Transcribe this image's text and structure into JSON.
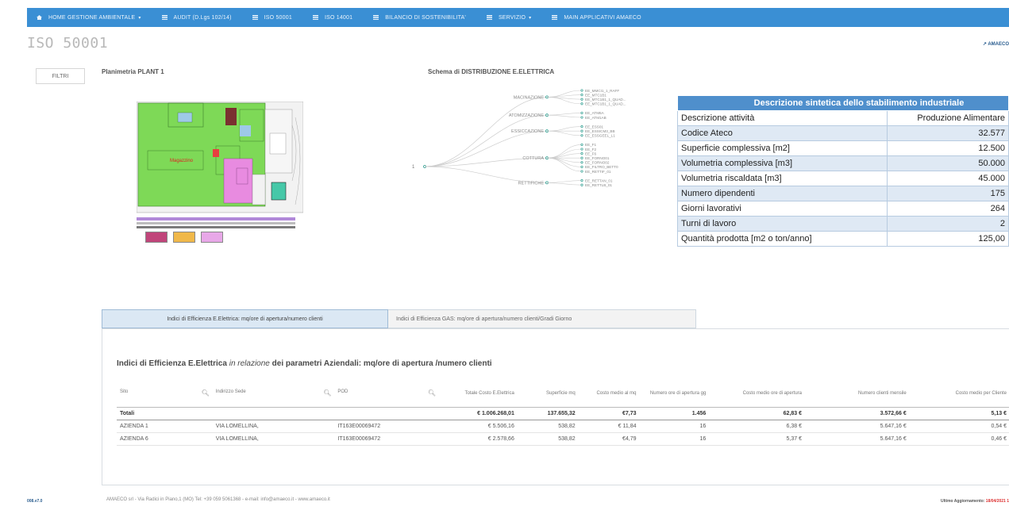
{
  "nav": {
    "items": [
      {
        "label": "HOME GESTIONE AMBIENTALE",
        "icon": "home-icon",
        "dropdown": true
      },
      {
        "label": "AUDIT (D.Lgs 102/14)",
        "icon": "list-icon",
        "dropdown": false
      },
      {
        "label": "ISO 50001",
        "icon": "list-icon",
        "dropdown": false
      },
      {
        "label": "ISO 14001",
        "icon": "list-icon",
        "dropdown": false
      },
      {
        "label": "BILANCIO DI SOSTENIBILITA'",
        "icon": "list-icon",
        "dropdown": false
      },
      {
        "label": "SERVIZIO",
        "icon": "list-icon",
        "dropdown": true
      },
      {
        "label": "MAIN APPLICATIVI AMAECO",
        "icon": "list-icon",
        "dropdown": false
      }
    ]
  },
  "page": {
    "title": "ISO 50001",
    "user_link": "↗ AMAECO"
  },
  "filter_button": "FILTRI",
  "planimetria": {
    "title": "Planimetria PLANT 1",
    "room_label": "Magazzino",
    "legend": [
      "",
      "",
      ""
    ]
  },
  "schema": {
    "title": "Schema di DISTRIBUZIONE E.ELETTRICA",
    "root": "1",
    "groups": [
      {
        "name": "MACINAZIONE",
        "leaves": [
          "EE_MMCI1_1_RAFF",
          "EE_MTC1B1",
          "EE_MTC1B1_1_QUAD...",
          "EE_MTC1B1_1_QUAD..."
        ]
      },
      {
        "name": "ATOMIZZAZIONE",
        "leaves": [
          "EE_ATM6A",
          "EE_ATM1AB"
        ]
      },
      {
        "name": "ESSICCAZIONE",
        "leaves": [
          "EE_ESS01",
          "EE_ESSICM3_BB",
          "EE_ESSGEEL_L1"
        ]
      },
      {
        "name": "COTTURA",
        "leaves": [
          "EE_F1",
          "EE_F2",
          "EE_F6",
          "EE_FORNO01",
          "EE_FORNO02",
          "EE_FILTRO_BETT0",
          "EE_RETTIF_01"
        ]
      },
      {
        "name": "RETTIFICHE",
        "leaves": [
          "EE_RETTAN_01",
          "EE_RETTLB_01"
        ]
      }
    ]
  },
  "description": {
    "header": "Descrizione sintetica dello stabilimento industriale",
    "rows": [
      {
        "label": "Descrizione attività",
        "value": "Produzione Alimentare"
      },
      {
        "label": "Codice Ateco",
        "value": "32.577"
      },
      {
        "label": "Superficie complessiva [m2]",
        "value": "12.500"
      },
      {
        "label": "Volumetria complessiva [m3]",
        "value": "50.000"
      },
      {
        "label": "Volumetria riscaldata [m3]",
        "value": "45.000"
      },
      {
        "label": "Numero dipendenti",
        "value": "175"
      },
      {
        "label": "Giorni lavorativi",
        "value": "264"
      },
      {
        "label": "Turni di lavoro",
        "value": "2"
      },
      {
        "label": "Quantità prodotta [m2 o ton/anno]",
        "value": "125,00"
      }
    ]
  },
  "tabs": [
    {
      "label": "Indici di Efficienza E.Elettrica: mq/ore di apertura/numero clienti",
      "active": true
    },
    {
      "label": "Indici di Efficienza GAS: mq/ore di apertura/numero clienti/Gradi Giorno",
      "active": false
    }
  ],
  "panel": {
    "title_strong": "Indici di Efficienza E.Elettrica",
    "title_em": "in relazione",
    "title_rest": "dei parametri Aziendali: mq/ore di apertura /numero clienti"
  },
  "grid": {
    "columns": [
      "Sito",
      "Indirizzo Sede",
      "POD",
      "Totale Costo E.Elettrica",
      "Superficie mq",
      "Costo medio al mq",
      "Numero ore di apertura gg",
      "Costo medio ore di apertura",
      "Numero clienti mensile",
      "Costo medio per Cliente"
    ],
    "total": [
      "Totali",
      "",
      "",
      "€ 1.006.268,01",
      "137.655,32",
      "€7,73",
      "1.456",
      "62,83 €",
      "3.572,66 €",
      "5,13 €"
    ],
    "rows": [
      [
        "AZIENDA 1",
        "VIA LOMELLINA,",
        "IT163E00069472",
        "€ 5.506,16",
        "538,82",
        "€ 11,84",
        "16",
        "6,38 €",
        "5.647,16 €",
        "0,54 €"
      ],
      [
        "AZIENDA 6",
        "VIA LOMELLINA,",
        "IT163E00069472",
        "€ 2.578,66",
        "538,82",
        "€4,79",
        "16",
        "5,37 €",
        "5.647,16 €",
        "0,46 €"
      ]
    ]
  },
  "footer": {
    "version": "008.v7.0",
    "text": "AMAECO srl - Via Radici in Piano,1 (MO) Tel: +39 059 5061368 - e-mail: info@amaeco.it - www.amaeco.it",
    "updated_label": "Ultimo Aggiornamento:",
    "updated_value": "18/04/2021 1"
  },
  "colors": {
    "nav": "#3a8fd4",
    "table_header": "#4f8fcc",
    "room_green": "#7ed957",
    "room_pink": "#e88be0"
  }
}
